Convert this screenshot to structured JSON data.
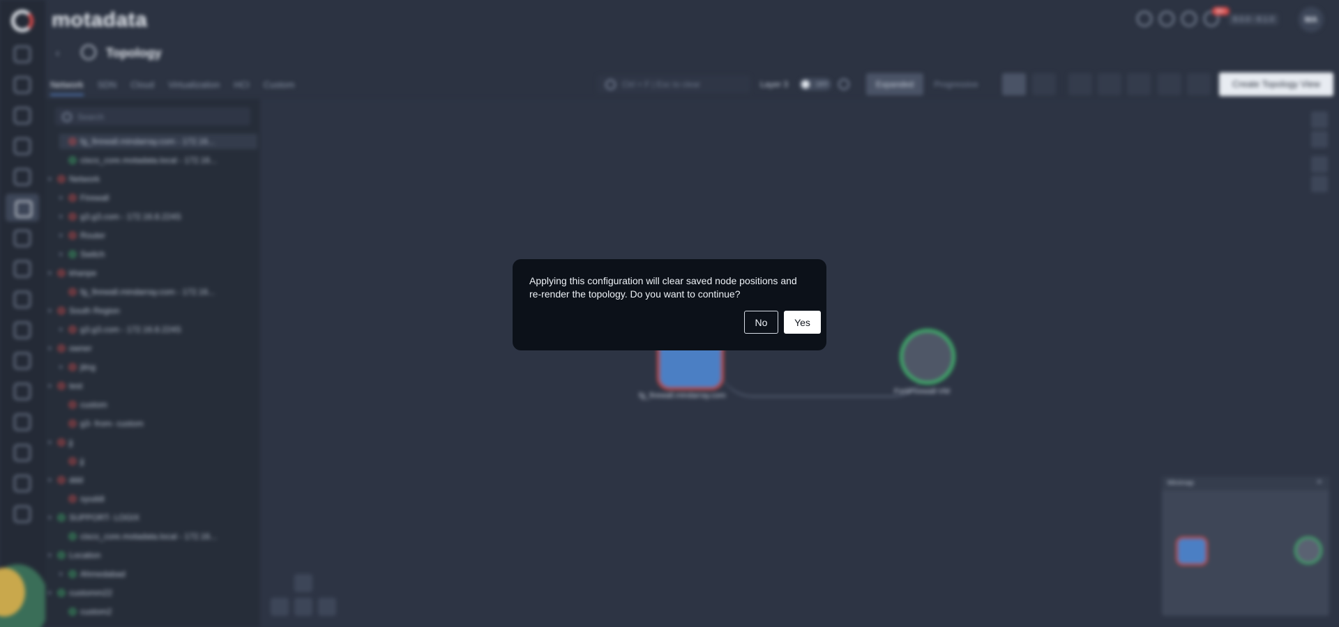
{
  "app": {
    "brand": "motadata",
    "version": "8.0.0 - 8.1.0",
    "avatar_initials": "MA",
    "notification_count": "99+"
  },
  "page": {
    "title": "Topology"
  },
  "tabs": [
    {
      "label": "Network"
    },
    {
      "label": "SDN"
    },
    {
      "label": "Cloud"
    },
    {
      "label": "Virtualization"
    },
    {
      "label": "HCI"
    },
    {
      "label": "Custom"
    }
  ],
  "toolbar": {
    "search_placeholder": "Ctrl + F | Esc to clear",
    "layer_label": "Layer 3",
    "toggle_label": "OFF",
    "expanded_label": "Expanded",
    "progressive_label": "Progressive",
    "create_label": "Create Topology View"
  },
  "tree": {
    "search_placeholder": "Search",
    "rows": [
      {
        "text": "fg_firewall.mindarray.com - 172.16..."
      },
      {
        "text": "cisco_core.motadata.local - 172.16..."
      },
      {
        "text": "Network"
      },
      {
        "text": "Firewall"
      },
      {
        "text": "g3.g3.com - 172.16.8.224S"
      },
      {
        "text": "Router"
      },
      {
        "text": "Switch"
      },
      {
        "text": "khanpe"
      },
      {
        "text": "fg_firewall.mindarray.com - 172.16..."
      },
      {
        "text": "South Region"
      },
      {
        "text": "g3.g3.com - 172.16.8.224S"
      },
      {
        "text": "owner"
      },
      {
        "text": "jitng"
      },
      {
        "text": "test"
      },
      {
        "text": "custom"
      },
      {
        "text": "g3- from- custom"
      },
      {
        "text": "jj"
      },
      {
        "text": "jj"
      },
      {
        "text": "ddd"
      },
      {
        "text": "syuddi"
      },
      {
        "text": "SUPPORT- LOGIX"
      },
      {
        "text": "cisco_core.motadata.local - 172.16..."
      },
      {
        "text": "Location"
      },
      {
        "text": "Ahmedabad"
      },
      {
        "text": "customm22"
      },
      {
        "text": "custom2"
      }
    ]
  },
  "canvas": {
    "node1_label": "fg_firewall.mindarray.com",
    "node2_label": "FortiFirewall-VM",
    "minimap_title": "Minimap"
  },
  "dialog": {
    "message": "Applying this configuration will clear saved node positions and re-render the topology. Do you want to continue?",
    "no_label": "No",
    "yes_label": "Yes"
  }
}
